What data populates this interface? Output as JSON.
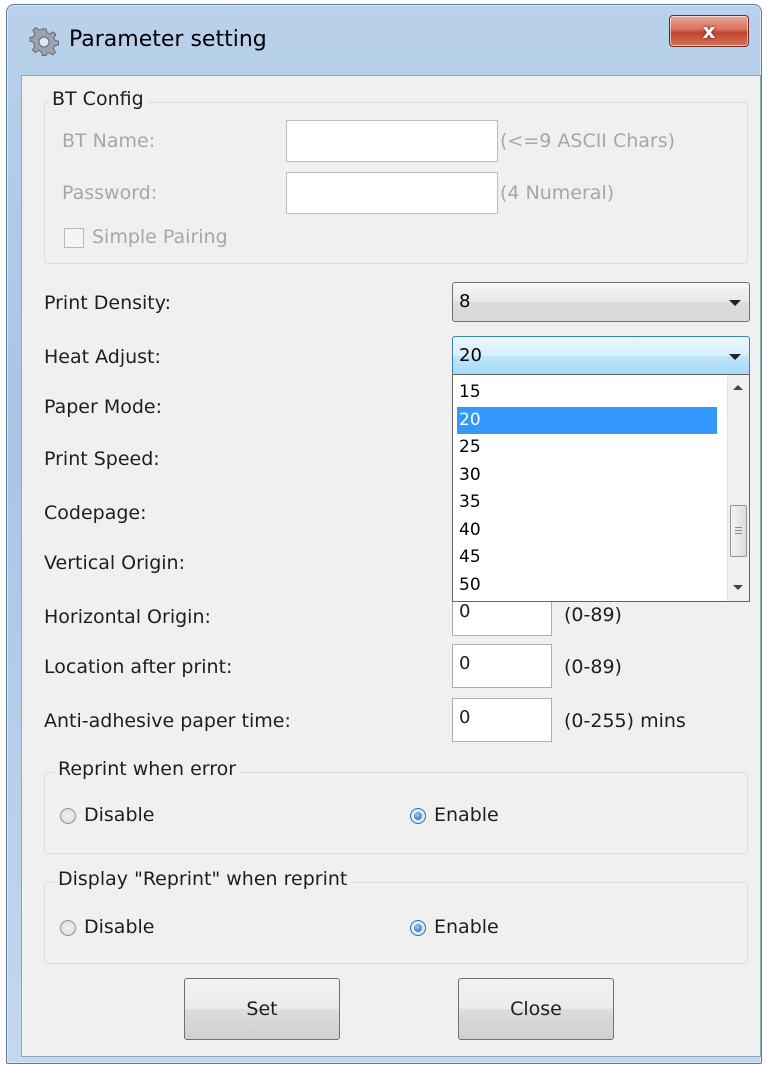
{
  "window": {
    "title": "Parameter setting",
    "close_glyph": "x"
  },
  "bt_config": {
    "legend": "BT Config",
    "bt_name_label": "BT Name:",
    "bt_name_value": "",
    "bt_name_hint": "(<=9 ASCII Chars)",
    "password_label": "Password:",
    "password_value": "",
    "password_hint": "(4 Numeral)",
    "simple_pairing_label": "Simple Pairing"
  },
  "fields": {
    "print_density_label": "Print Density:",
    "print_density_value": "8",
    "heat_adjust_label": "Heat Adjust:",
    "heat_adjust_value": "20",
    "paper_mode_label": "Paper Mode:",
    "print_speed_label": "Print Speed:",
    "codepage_label": "Codepage:",
    "vertical_origin_label": "Vertical Origin:",
    "horizontal_origin_label": "Horizontal Origin:",
    "horizontal_origin_value": "0",
    "horizontal_origin_hint": "(0-89)",
    "location_after_print_label": "Location after print:",
    "location_after_print_value": "0",
    "location_after_print_hint": "(0-89)",
    "anti_adhesive_label": "Anti-adhesive paper time:",
    "anti_adhesive_value": "0",
    "anti_adhesive_hint": "(0-255) mins"
  },
  "heat_dropdown": {
    "options": [
      "15",
      "20",
      "25",
      "30",
      "35",
      "40",
      "45",
      "50"
    ],
    "selected": "20"
  },
  "reprint_when_error": {
    "legend": "Reprint when error",
    "disable_label": "Disable",
    "enable_label": "Enable",
    "selected": "Enable"
  },
  "display_reprint": {
    "legend": "Display \"Reprint\" when reprint",
    "disable_label": "Disable",
    "enable_label": "Enable",
    "selected": "Enable"
  },
  "buttons": {
    "set_label": "Set",
    "close_label": "Close"
  },
  "icons": {
    "title": "gear-icon",
    "close": "close-icon",
    "dropdown": "chevron-down-icon"
  }
}
